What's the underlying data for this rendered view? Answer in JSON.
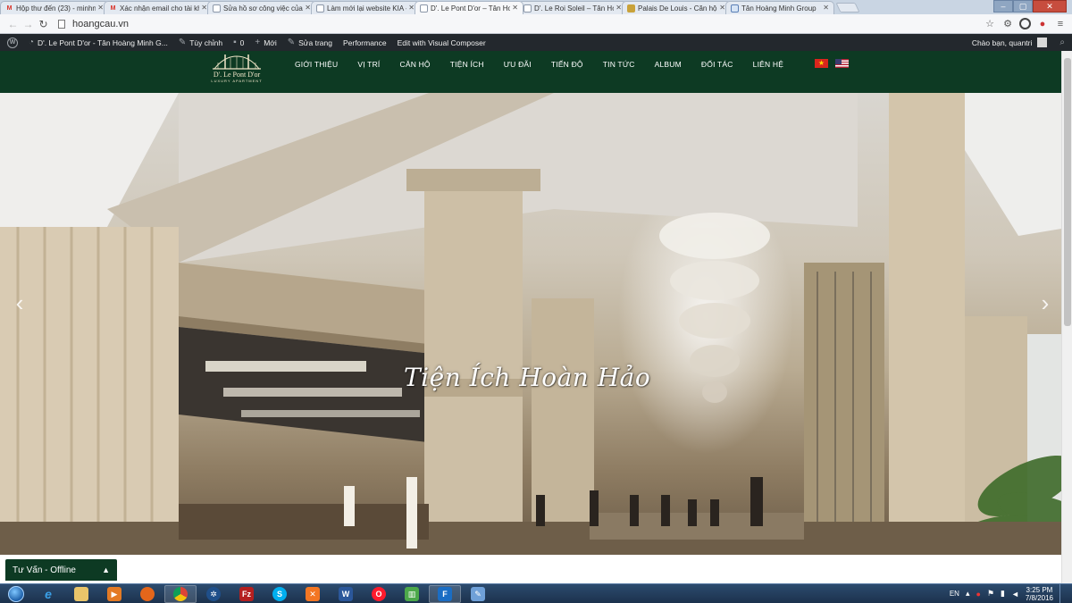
{
  "browser": {
    "tabs": [
      {
        "title": "Hộp thư đến (23) - minhn",
        "icon": "gmail-icon",
        "active": false
      },
      {
        "title": "Xác nhận email cho tài kh",
        "icon": "gmail-icon",
        "active": false
      },
      {
        "title": "Sửa hồ sơ công việc của T",
        "icon": "page-icon",
        "active": false
      },
      {
        "title": "Làm mới lại website KIA -",
        "icon": "page-icon",
        "active": false
      },
      {
        "title": "D'. Le Pont D'or – Tân Hoà",
        "icon": "page-icon",
        "active": true
      },
      {
        "title": "D'. Le Roi Soleil – Tân Hoà",
        "icon": "page-icon",
        "active": false
      },
      {
        "title": "Palais De Louis - Căn hộ 8",
        "icon": "gold-icon",
        "active": false
      },
      {
        "title": "Tân Hoàng Minh Group",
        "icon": "globe-icon",
        "active": false
      }
    ],
    "url": "hoangcau.vn"
  },
  "adminbar": {
    "site_name": "D'. Le Pont D'or - Tân Hoàng Minh G...",
    "customize": "Tùy chỉnh",
    "comments": "0",
    "new": "Mới",
    "edit_page": "Sửa trang",
    "performance": "Performance",
    "visual_composer": "Edit with Visual Composer",
    "greeting": "Chào bạn, quantri"
  },
  "site": {
    "logo_name": "D'. Le Pont D'or",
    "logo_tagline": "LUXURY APARTMENT",
    "menu": [
      "GIỚI THIỆU",
      "VỊ TRÍ",
      "CĂN HỘ",
      "TIỆN ÍCH",
      "ƯU ĐÃI",
      "TIẾN ĐỘ",
      "TIN TỨC",
      "ALBUM",
      "ĐỐI TÁC",
      "LIÊN HỆ"
    ],
    "flags": [
      "vietnam-flag-icon",
      "usa-flag-icon"
    ]
  },
  "hero": {
    "title": "Tiện Ích Hoàn Hảo"
  },
  "chat": {
    "label": "Tư Vấn - Offline"
  },
  "taskbar": {
    "language": "EN",
    "time": "3:25 PM",
    "date": "7/8/2016",
    "apps": [
      "ie-icon",
      "explorer-icon",
      "media-player-icon",
      "firefox-icon",
      "chrome-icon",
      "network-icon",
      "filezilla-icon",
      "skype-icon",
      "xampp-icon",
      "word-icon",
      "opera-icon",
      "chart-app-icon",
      "f-app-icon",
      "paint-icon"
    ]
  }
}
